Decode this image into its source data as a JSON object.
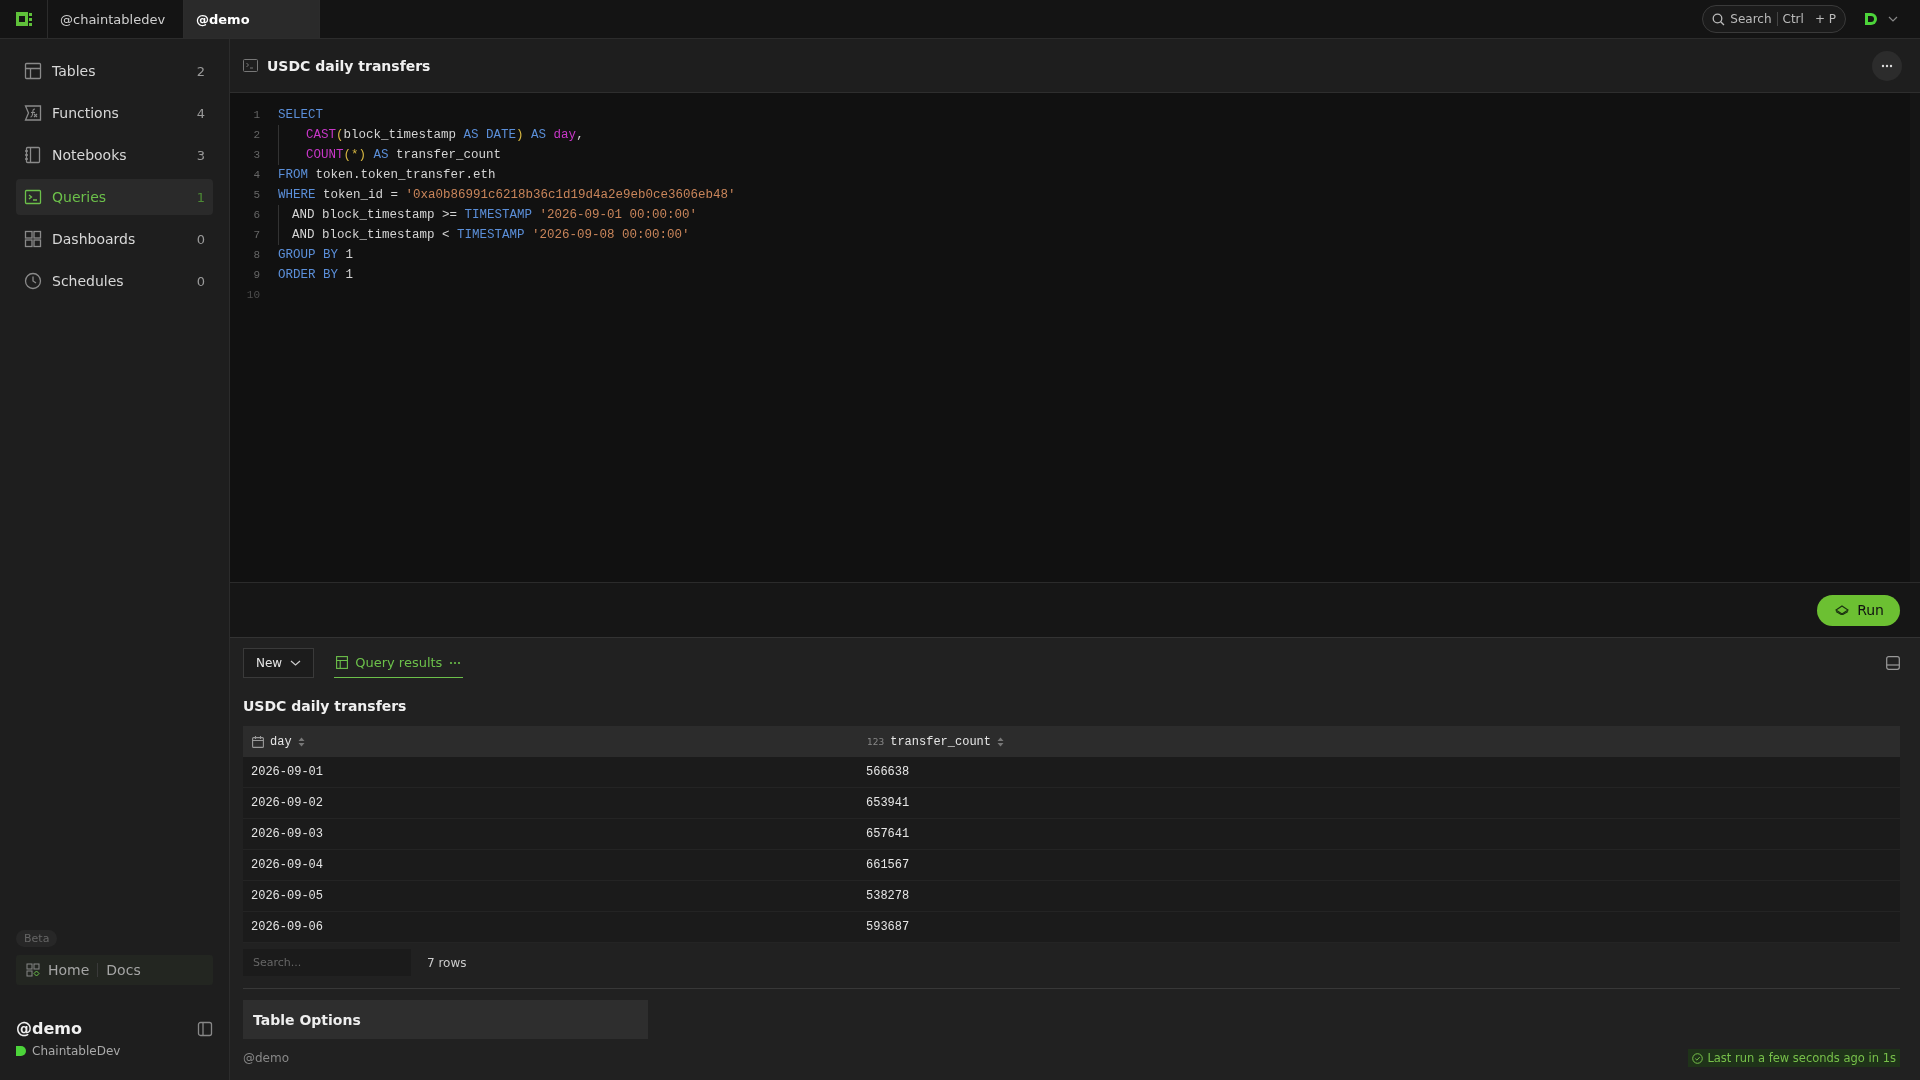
{
  "top_bar": {
    "workspace_tabs": [
      {
        "label": "@chaintabledev",
        "selected": false
      },
      {
        "label": "@demo",
        "selected": true
      }
    ],
    "search": {
      "label": "Search",
      "key": "Ctrl",
      "plus": "+ P"
    }
  },
  "sidebar": {
    "items": [
      {
        "kind": "tables",
        "label": "Tables",
        "count": "2",
        "selected": false
      },
      {
        "kind": "functions",
        "label": "Functions",
        "count": "4",
        "selected": false
      },
      {
        "kind": "notebooks",
        "label": "Notebooks",
        "count": "3",
        "selected": false
      },
      {
        "kind": "queries",
        "label": "Queries",
        "count": "1",
        "selected": true
      },
      {
        "kind": "dashboards",
        "label": "Dashboards",
        "count": "0",
        "selected": false
      },
      {
        "kind": "schedules",
        "label": "Schedules",
        "count": "0",
        "selected": false
      }
    ],
    "badge": "Beta",
    "links": [
      "Home",
      "Docs"
    ],
    "user": {
      "handle": "@demo",
      "org": "ChaintableDev"
    }
  },
  "query": {
    "title": "USDC daily transfers",
    "lines": [
      {
        "number": "1",
        "kind": "top",
        "tokens": [
          {
            "kind": "keyword",
            "text": "SELECT"
          }
        ]
      },
      {
        "number": "2",
        "kind": "item",
        "tokens": [
          {
            "kind": "function",
            "text": "CAST"
          },
          {
            "kind": "paren",
            "text": "("
          },
          {
            "kind": "plain",
            "text": "block_timestamp "
          },
          {
            "kind": "keyword",
            "text": "AS DATE"
          },
          {
            "kind": "paren",
            "text": ")"
          },
          {
            "kind": "keyword",
            "text": " AS "
          },
          {
            "kind": "alias",
            "text": "day"
          },
          {
            "kind": "plain",
            "text": ","
          }
        ]
      },
      {
        "number": "3",
        "kind": "item",
        "tokens": [
          {
            "kind": "function",
            "text": "COUNT"
          },
          {
            "kind": "paren",
            "text": "(*)"
          },
          {
            "kind": "keyword",
            "text": " AS "
          },
          {
            "kind": "plain",
            "text": "transfer_count"
          }
        ]
      },
      {
        "number": "4",
        "kind": "top",
        "tokens": [
          {
            "kind": "keyword",
            "text": "FROM "
          },
          {
            "kind": "plain",
            "text": "token.token_transfer.eth"
          }
        ]
      },
      {
        "number": "5",
        "kind": "top",
        "tokens": [
          {
            "kind": "keyword",
            "text": "WHERE "
          },
          {
            "kind": "plain",
            "text": "token_id = "
          },
          {
            "kind": "string",
            "text": "'0xa0b86991c6218b36c1d19d4a2e9eb0ce3606eb48'"
          }
        ]
      },
      {
        "number": "6",
        "kind": "condition",
        "tokens": [
          {
            "kind": "plain",
            "text": "AND block_timestamp >= "
          },
          {
            "kind": "keyword",
            "text": "TIMESTAMP "
          },
          {
            "kind": "string",
            "text": "'2026-09-01 00:00:00'"
          }
        ]
      },
      {
        "number": "7",
        "kind": "condition",
        "tokens": [
          {
            "kind": "plain",
            "text": "AND block_timestamp < "
          },
          {
            "kind": "keyword",
            "text": "TIMESTAMP "
          },
          {
            "kind": "string",
            "text": "'2026-09-08 00:00:00'"
          }
        ]
      },
      {
        "number": "8",
        "kind": "top",
        "tokens": [
          {
            "kind": "keyword",
            "text": "GROUP BY "
          },
          {
            "kind": "plain",
            "text": "1"
          }
        ]
      },
      {
        "number": "9",
        "kind": "top",
        "tokens": [
          {
            "kind": "keyword",
            "text": "ORDER BY "
          },
          {
            "kind": "plain",
            "text": "1"
          }
        ]
      },
      {
        "number": "10",
        "kind": "empty"
      }
    ]
  },
  "run_button": "Run",
  "results": {
    "new_button": "New",
    "tabs": [
      {
        "label": "Query results",
        "selected": true
      }
    ],
    "title": "USDC daily transfers",
    "columns": [
      {
        "name": "day",
        "kind": "date"
      },
      {
        "name": "transfer_count",
        "kind": "number",
        "type_label": "123"
      }
    ],
    "rows": [
      [
        "2026-09-01",
        "566638"
      ],
      [
        "2026-09-02",
        "653941"
      ],
      [
        "2026-09-03",
        "657641"
      ],
      [
        "2026-09-04",
        "661567"
      ],
      [
        "2026-09-05",
        "538278"
      ],
      [
        "2026-09-06",
        "593687"
      ]
    ],
    "search_placeholder": "Search...",
    "row_count": "7 rows",
    "options_title": "Table Options",
    "owner": "@demo",
    "status": "Last run a few seconds ago in 1s"
  }
}
